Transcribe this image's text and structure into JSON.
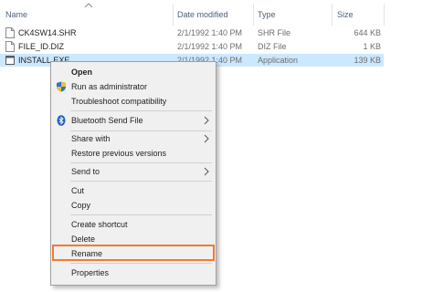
{
  "columns": {
    "name": "Name",
    "date_modified": "Date modified",
    "type": "Type",
    "size": "Size"
  },
  "files": [
    {
      "name": "CK4SW14.SHR",
      "date": "2/1/1992 1:40 PM",
      "type": "SHR File",
      "size": "644 KB",
      "icon": "document-icon"
    },
    {
      "name": "FILE_ID.DIZ",
      "date": "2/1/1992 1:40 PM",
      "type": "DIZ File",
      "size": "1 KB",
      "icon": "document-icon"
    },
    {
      "name": "INSTALL.EXE",
      "date": "2/1/1992 1:40 PM",
      "type": "Application",
      "size": "139 KB",
      "icon": "application-icon",
      "selected": true
    }
  ],
  "context_menu": {
    "open": "Open",
    "run_as_admin": "Run as administrator",
    "troubleshoot": "Troubleshoot compatibility",
    "bluetooth": "Bluetooth Send File",
    "share_with": "Share with",
    "restore": "Restore previous versions",
    "send_to": "Send to",
    "cut": "Cut",
    "copy": "Copy",
    "create_shortcut": "Create shortcut",
    "delete": "Delete",
    "rename": "Rename",
    "properties": "Properties"
  },
  "colors": {
    "selection": "#cce8ff",
    "highlight_border": "#ee7d2f",
    "menu_bg": "#f0f0f0",
    "header_text": "#4c607a"
  }
}
